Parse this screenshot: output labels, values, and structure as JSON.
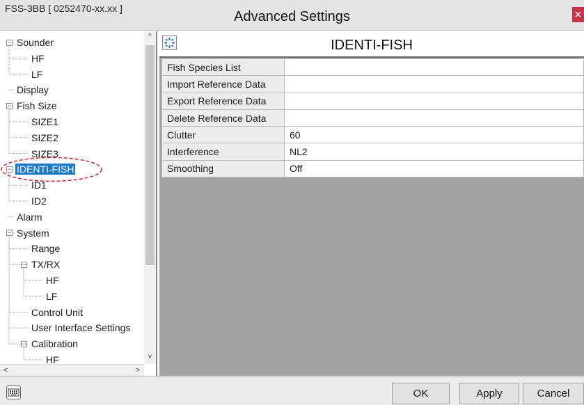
{
  "titlebar": {
    "device_id": "FSS-3BB [ 0252470-xx.xx ]",
    "title": "Advanced Settings",
    "close_label": "×"
  },
  "tree": {
    "items": [
      {
        "label": "Sounder",
        "level": 0,
        "expander": true
      },
      {
        "label": "HF",
        "level": 1
      },
      {
        "label": "LF",
        "level": 1
      },
      {
        "label": "Display",
        "level": 0
      },
      {
        "label": "Fish Size",
        "level": 0,
        "expander": true
      },
      {
        "label": "SIZE1",
        "level": 1
      },
      {
        "label": "SIZE2",
        "level": 1
      },
      {
        "label": "SIZE3",
        "level": 1
      },
      {
        "label": "IDENTI-FISH",
        "level": 0,
        "expander": true,
        "selected": true
      },
      {
        "label": "ID1",
        "level": 1
      },
      {
        "label": "ID2",
        "level": 1
      },
      {
        "label": "Alarm",
        "level": 0
      },
      {
        "label": "System",
        "level": 0,
        "expander": true
      },
      {
        "label": "Range",
        "level": 1
      },
      {
        "label": "TX/RX",
        "level": 1,
        "expander": true
      },
      {
        "label": "HF",
        "level": 2
      },
      {
        "label": "LF",
        "level": 2
      },
      {
        "label": "Control Unit",
        "level": 1
      },
      {
        "label": "User Interface Settings",
        "level": 1
      },
      {
        "label": "Calibration",
        "level": 1,
        "expander": true
      },
      {
        "label": "HF",
        "level": 2
      }
    ],
    "highlight_color": "#1e78c8",
    "annotation_color": "#d0202a"
  },
  "panel": {
    "title": "IDENTI-FISH",
    "icon": "identi-fish-icon",
    "rows": [
      {
        "name": "Fish Species List",
        "value": ""
      },
      {
        "name": "Import Reference Data",
        "value": ""
      },
      {
        "name": "Export Reference Data",
        "value": ""
      },
      {
        "name": "Delete Reference Data",
        "value": ""
      },
      {
        "name": "Clutter",
        "value": "60"
      },
      {
        "name": "Interference",
        "value": "NL2"
      },
      {
        "name": "Smoothing",
        "value": "Off"
      }
    ]
  },
  "footer": {
    "keyboard_icon": "keyboard-icon",
    "ok_label": "OK",
    "apply_label": "Apply",
    "cancel_label": "Cancel"
  }
}
